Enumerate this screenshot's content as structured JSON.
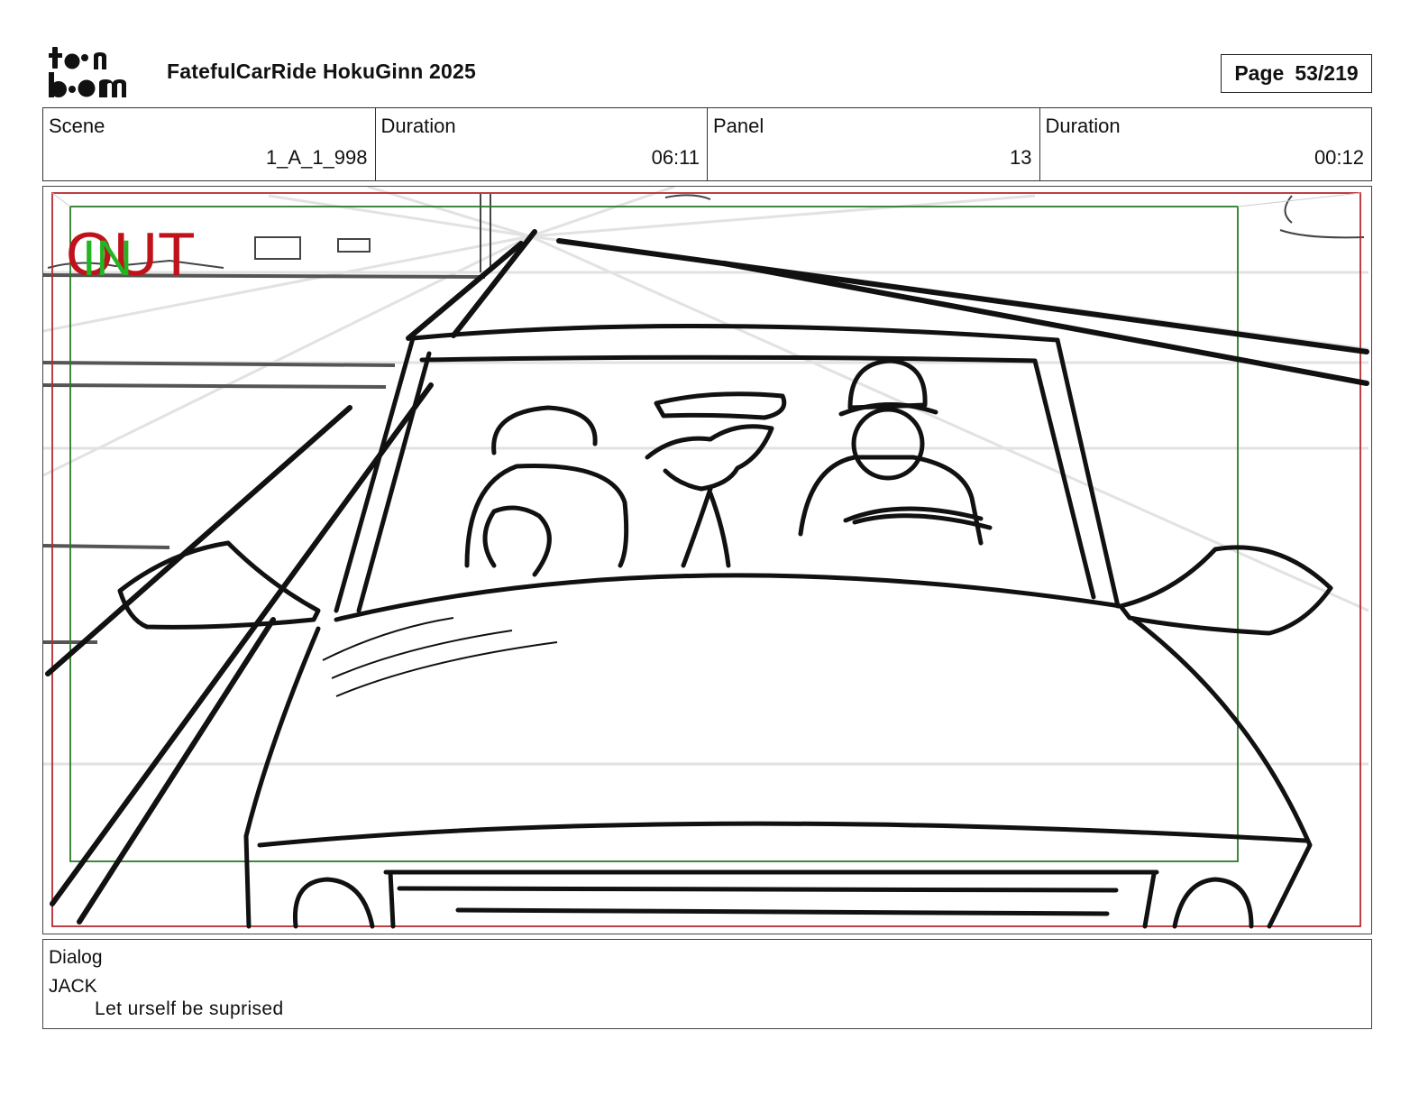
{
  "header": {
    "logo_lines": [
      "toon",
      "boom"
    ],
    "project_title": "FatefulCarRide HokuGinn 2025",
    "page_label": "Page",
    "page_value": "53/219"
  },
  "info": {
    "scene_label": "Scene",
    "scene_value": "1_A_1_998",
    "scene_duration_label": "Duration",
    "scene_duration_value": "06:11",
    "panel_label": "Panel",
    "panel_value": "13",
    "panel_duration_label": "Duration",
    "panel_duration_value": "00:12"
  },
  "panel": {
    "out_marker": "OUT",
    "in_marker": "IN",
    "out_color": "#c0121b",
    "in_color": "#22b522",
    "safe_frame_outer_color": "#b52a30",
    "safe_frame_inner_color": "#2a7a2a"
  },
  "dialog": {
    "label": "Dialog",
    "character": "JACK",
    "line": "Let urself be suprised"
  }
}
